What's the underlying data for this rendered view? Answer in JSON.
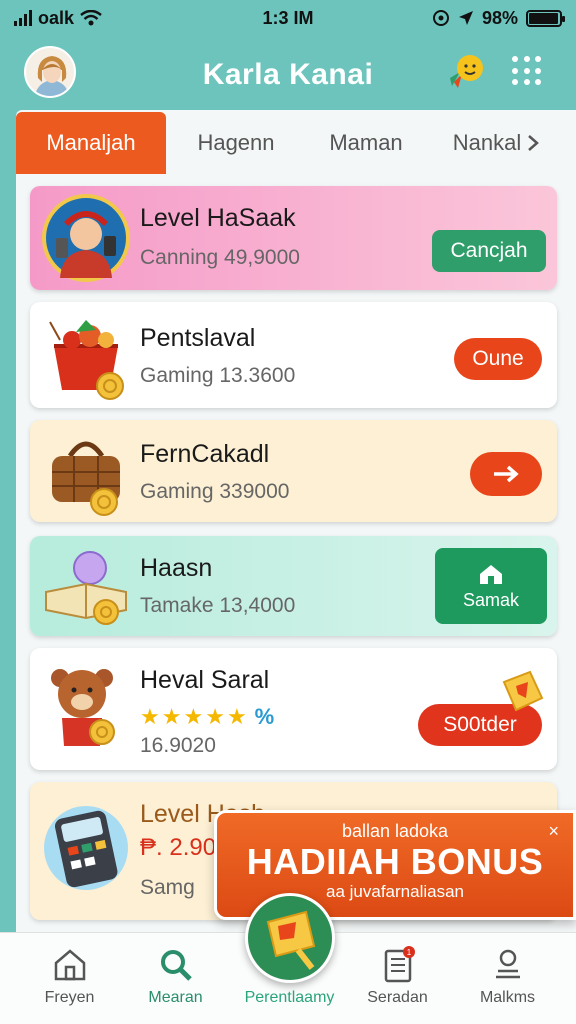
{
  "status_bar": {
    "carrier": "oalk",
    "time": "1:3 IM",
    "battery": "98%",
    "battery_level": 0.98
  },
  "header": {
    "title": "Karla Kanai"
  },
  "tabs": [
    {
      "label": "Manaljah",
      "active": true
    },
    {
      "label": "Hagenn",
      "active": false
    },
    {
      "label": "Maman",
      "active": false
    },
    {
      "label": "Nankal",
      "active": false
    }
  ],
  "cards": [
    {
      "title": "Level HaSaak",
      "subtitle": "Canning 49,9000",
      "button": "Cancjah",
      "bg": "#f6a3c9",
      "button_color": "#2f9e6a"
    },
    {
      "title": "Pentslaval",
      "subtitle": "Gaming 13.3600",
      "button": "Oune",
      "bg": "#ffffff",
      "button_color": "#e8461a"
    },
    {
      "title": "FernCakadl",
      "subtitle": "Gaming 339000",
      "button": "arrow-right",
      "bg": "#fdf0d4",
      "button_color": "#e8461a"
    },
    {
      "title": "Haasn",
      "subtitle": "Tamake 13,4000",
      "button": "Samak",
      "bg": "#bfeee1",
      "button_color": "#1f9a5f"
    },
    {
      "title": "Heval Saral",
      "subtitle": "16.9020",
      "rating": "%",
      "stars": 5,
      "button": "S00tder",
      "bg": "#ffffff",
      "button_color": "#e0341c"
    },
    {
      "title": "Level Hasb",
      "price": "₱. 2.90",
      "subtitle": "Samg",
      "bg": "#fdf0d4"
    }
  ],
  "bonus_popup": {
    "top_text": "ballan ladoka",
    "headline": "HADIIAH BONUS",
    "bottom_text": "aa juvafarnaliasan",
    "close": "×"
  },
  "bottom_nav": [
    {
      "label": "Freyen",
      "icon": "home-icon"
    },
    {
      "label": "Mearan",
      "icon": "search-icon"
    },
    {
      "label": "Perentlaamy",
      "icon": "gift-icon",
      "active": true
    },
    {
      "label": "Seradan",
      "icon": "document-icon",
      "badge": "1"
    },
    {
      "label": "Malkms",
      "icon": "profile-icon"
    }
  ]
}
